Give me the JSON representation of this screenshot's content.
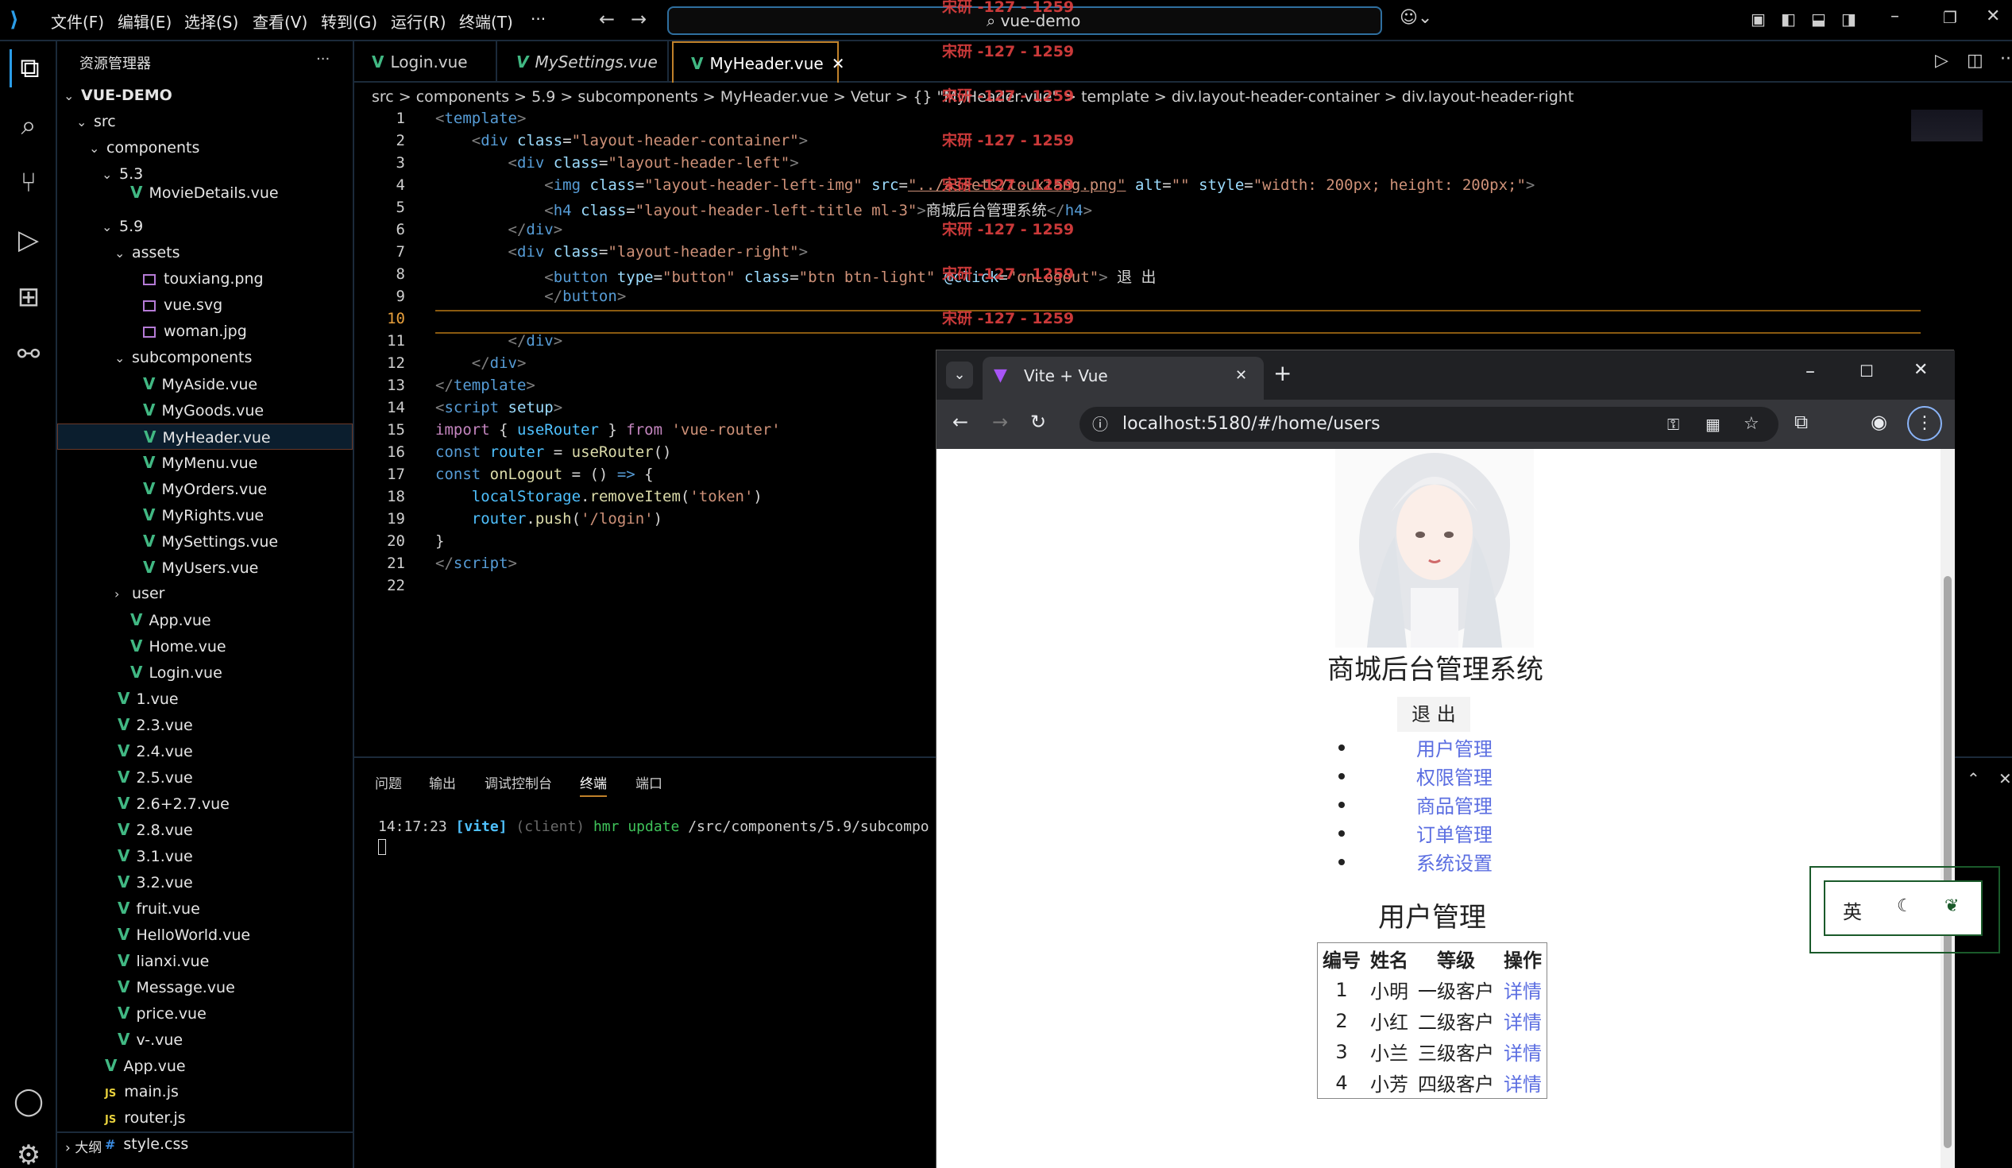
{
  "titlebar": {
    "menus": [
      "文件(F)",
      "编辑(E)",
      "选择(S)",
      "查看(V)",
      "转到(G)",
      "运行(R)",
      "终端(T)",
      "···"
    ],
    "search": "vue-demo"
  },
  "sidebar": {
    "title": "资源管理器",
    "more": "···",
    "tree": [
      {
        "label": "VUE-DEMO",
        "indent": 0,
        "kind": "root"
      },
      {
        "label": "src",
        "indent": 1,
        "kind": "folder"
      },
      {
        "label": "components",
        "indent": 2,
        "kind": "folder"
      },
      {
        "label": "5.3",
        "indent": 3,
        "kind": "folder"
      },
      {
        "label": "MovieDetails.vue",
        "indent": 4,
        "kind": "vue"
      },
      {
        "label": "5.9",
        "indent": 3,
        "kind": "folder"
      },
      {
        "label": "assets",
        "indent": 4,
        "kind": "folder"
      },
      {
        "label": "touxiang.png",
        "indent": 5,
        "kind": "img"
      },
      {
        "label": "vue.svg",
        "indent": 5,
        "kind": "img"
      },
      {
        "label": "woman.jpg",
        "indent": 5,
        "kind": "img"
      },
      {
        "label": "subcomponents",
        "indent": 4,
        "kind": "folder"
      },
      {
        "label": "MyAside.vue",
        "indent": 5,
        "kind": "vue"
      },
      {
        "label": "MyGoods.vue",
        "indent": 5,
        "kind": "vue"
      },
      {
        "label": "MyHeader.vue",
        "indent": 5,
        "kind": "vue"
      },
      {
        "label": "MyMenu.vue",
        "indent": 5,
        "kind": "vue"
      },
      {
        "label": "MyOrders.vue",
        "indent": 5,
        "kind": "vue"
      },
      {
        "label": "MyRights.vue",
        "indent": 5,
        "kind": "vue"
      },
      {
        "label": "MySettings.vue",
        "indent": 5,
        "kind": "vue"
      },
      {
        "label": "MyUsers.vue",
        "indent": 5,
        "kind": "vue"
      },
      {
        "label": "user",
        "indent": 4,
        "kind": "folder-closed"
      },
      {
        "label": "App.vue",
        "indent": 4,
        "kind": "vue"
      },
      {
        "label": "Home.vue",
        "indent": 4,
        "kind": "vue"
      },
      {
        "label": "Login.vue",
        "indent": 4,
        "kind": "vue"
      },
      {
        "label": "1.vue",
        "indent": 3,
        "kind": "vue"
      },
      {
        "label": "2.3.vue",
        "indent": 3,
        "kind": "vue"
      },
      {
        "label": "2.4.vue",
        "indent": 3,
        "kind": "vue"
      },
      {
        "label": "2.5.vue",
        "indent": 3,
        "kind": "vue"
      },
      {
        "label": "2.6+2.7.vue",
        "indent": 3,
        "kind": "vue"
      },
      {
        "label": "2.8.vue",
        "indent": 3,
        "kind": "vue"
      },
      {
        "label": "3.1.vue",
        "indent": 3,
        "kind": "vue"
      },
      {
        "label": "3.2.vue",
        "indent": 3,
        "kind": "vue"
      },
      {
        "label": "fruit.vue",
        "indent": 3,
        "kind": "vue"
      },
      {
        "label": "HelloWorld.vue",
        "indent": 3,
        "kind": "vue"
      },
      {
        "label": "lianxi.vue",
        "indent": 3,
        "kind": "vue"
      },
      {
        "label": "Message.vue",
        "indent": 3,
        "kind": "vue"
      },
      {
        "label": "price.vue",
        "indent": 3,
        "kind": "vue"
      },
      {
        "label": "v-.vue",
        "indent": 3,
        "kind": "vue"
      },
      {
        "label": "App.vue",
        "indent": 2,
        "kind": "vue"
      },
      {
        "label": "main.js",
        "indent": 2,
        "kind": "js"
      },
      {
        "label": "router.js",
        "indent": 2,
        "kind": "js"
      },
      {
        "label": "style.css",
        "indent": 2,
        "kind": "css"
      }
    ],
    "outline": "大纲"
  },
  "tabs": [
    {
      "label": "Login.vue",
      "italic": false,
      "active": false
    },
    {
      "label": "MySettings.vue",
      "italic": true,
      "active": false
    },
    {
      "label": "MyHeader.vue",
      "italic": false,
      "active": true
    }
  ],
  "breadcrumb": "src > components > 5.9 > subcomponents > MyHeader.vue > Vetur > {} \"MyHeader.vue\" > template > div.layout-header-container > div.layout-header-right",
  "editor": {
    "line_numbers": [
      "1",
      "2",
      "3",
      "4",
      "5",
      "6",
      "7",
      "8",
      "9",
      "10",
      "11",
      "12",
      "13",
      "14",
      "15",
      "16",
      "17",
      "18",
      "19",
      "20",
      "21",
      "22"
    ],
    "current_line": "10"
  },
  "panel": {
    "tabs": [
      "问题",
      "输出",
      "调试控制台",
      "终端",
      "端口"
    ],
    "active_tab": "终端",
    "term_time": "14:17:23",
    "term_vite": "[vite]",
    "term_client": "(client)",
    "term_hmr": "hmr update",
    "term_path": "/src/components/5.9/subcompo"
  },
  "watermark": "宋研 -127 - 1259",
  "browser": {
    "tab_title": "Vite + Vue",
    "url": "localhost:5180/#/home/users",
    "page": {
      "title": "商城后台管理系统",
      "logout": "退 出",
      "nav": [
        "用户管理",
        "权限管理",
        "商品管理",
        "订单管理",
        "系统设置"
      ],
      "section": "用户管理",
      "table": {
        "headers": [
          "编号",
          "姓名",
          "等级",
          "操作"
        ],
        "rows": [
          [
            "1",
            "小明",
            "一级客户",
            "详情"
          ],
          [
            "2",
            "小红",
            "二级客户",
            "详情"
          ],
          [
            "3",
            "小兰",
            "三级客户",
            "详情"
          ],
          [
            "4",
            "小芳",
            "四级客户",
            "详情"
          ]
        ]
      }
    }
  },
  "ime": {
    "lang": "英"
  }
}
